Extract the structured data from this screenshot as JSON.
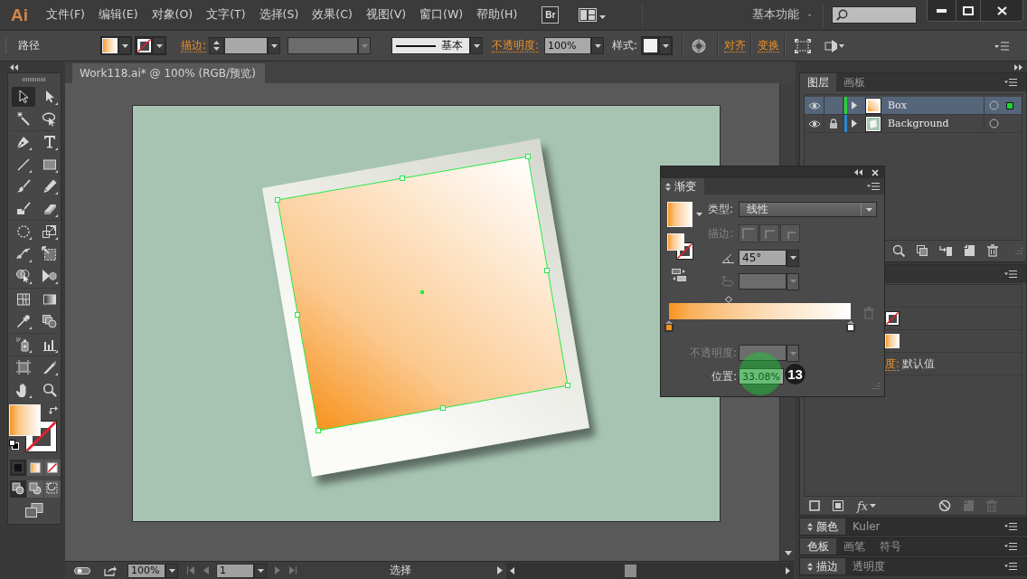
{
  "menubar": {
    "logo": "Ai",
    "items": [
      "文件(F)",
      "编辑(E)",
      "对象(O)",
      "文字(T)",
      "选择(S)",
      "效果(C)",
      "视图(V)",
      "窗口(W)",
      "帮助(H)"
    ],
    "bridge": "Br",
    "workspace": "基本功能"
  },
  "control_bar": {
    "selection": "路径",
    "stroke_link": "描边:",
    "stroke_profile": "基本",
    "opacity_link": "不透明度:",
    "opacity_value": "100%",
    "style_label": "样式:",
    "align_link": "对齐",
    "transform_link": "变换"
  },
  "toolbox": {
    "tools": [
      {
        "selected": true
      },
      {
        "selected": false
      },
      {
        "selected": false
      },
      {
        "selected": false
      },
      {
        "selected": false
      },
      {
        "selected": false
      },
      {
        "selected": false
      },
      {
        "selected": false
      },
      {
        "selected": false
      },
      {
        "selected": false
      },
      {
        "selected": false
      },
      {
        "selected": false
      },
      {
        "selected": false
      },
      {
        "selected": false
      },
      {
        "selected": false
      },
      {
        "selected": false
      },
      {
        "selected": false
      },
      {
        "selected": false
      },
      {
        "selected": false
      },
      {
        "selected": false
      },
      {
        "selected": false
      },
      {
        "selected": false
      },
      {
        "selected": false
      },
      {
        "selected": false
      },
      {
        "selected": false
      },
      {
        "selected": false
      },
      {
        "selected": false
      },
      {
        "selected": false
      }
    ],
    "fill": {
      "kind": "gradient"
    },
    "stroke": {
      "kind": "none"
    },
    "draw_modes": [
      {
        "selected": true
      },
      {
        "selected": false
      },
      {
        "selected": false
      }
    ]
  },
  "document": {
    "tab": "Work118.ai* @ 100% (RGB/预览)"
  },
  "gradient_panel": {
    "tab": "渐变",
    "type_label": "类型:",
    "type_value": "线性",
    "stroke_label": "描边:",
    "stroke_enabled": false,
    "angle_value": "45°",
    "aspect_enabled": false,
    "midpoint": {
      "level": 0.33
    },
    "stops": [
      {
        "level": 0,
        "color": "#f7931e"
      },
      {
        "level": 1,
        "color": "#ffffff"
      }
    ],
    "opacity_label": "不透明度:",
    "opacity_enabled": false,
    "location_label": "位置:",
    "location_value": "33.08%"
  },
  "step_marker": {
    "label": "13"
  },
  "layers_panel": {
    "tabs": [
      {
        "label": "图层",
        "selected": true
      },
      {
        "label": "画板",
        "selected": false
      }
    ],
    "layers": [
      {
        "name": "Box",
        "visible": true,
        "locked": false,
        "selected": true,
        "color": "#22d42e",
        "has_selected_art": true
      },
      {
        "name": "Background",
        "visible": true,
        "locked": true,
        "selected": false,
        "color": "#2a86d0",
        "has_selected_art": false
      }
    ]
  },
  "appearance_panel": {
    "rows": [
      {
        "kind": "header"
      },
      {
        "kind": "stroke",
        "swatch": {
          "kind": "none"
        }
      },
      {
        "kind": "fill",
        "swatch": {
          "kind": "gradient"
        }
      },
      {
        "kind": "opacity",
        "label": "度:",
        "value": "默认值"
      }
    ],
    "fx_label": "fx"
  },
  "collapsed_panels": [
    {
      "options_toggle": true,
      "tabs": [
        {
          "label": "颜色",
          "selected": true
        },
        {
          "label": "Kuler",
          "selected": false
        }
      ]
    },
    {
      "options_toggle": false,
      "tabs": [
        {
          "label": "色板",
          "selected": true
        },
        {
          "label": "画笔",
          "selected": false
        },
        {
          "label": "符号",
          "selected": false
        }
      ]
    },
    {
      "options_toggle": true,
      "tabs": [
        {
          "label": "描边",
          "selected": true
        },
        {
          "label": "透明度",
          "selected": false
        }
      ]
    }
  ],
  "status_bar": {
    "zoom": "100%",
    "page": "1",
    "tool": "选择"
  }
}
